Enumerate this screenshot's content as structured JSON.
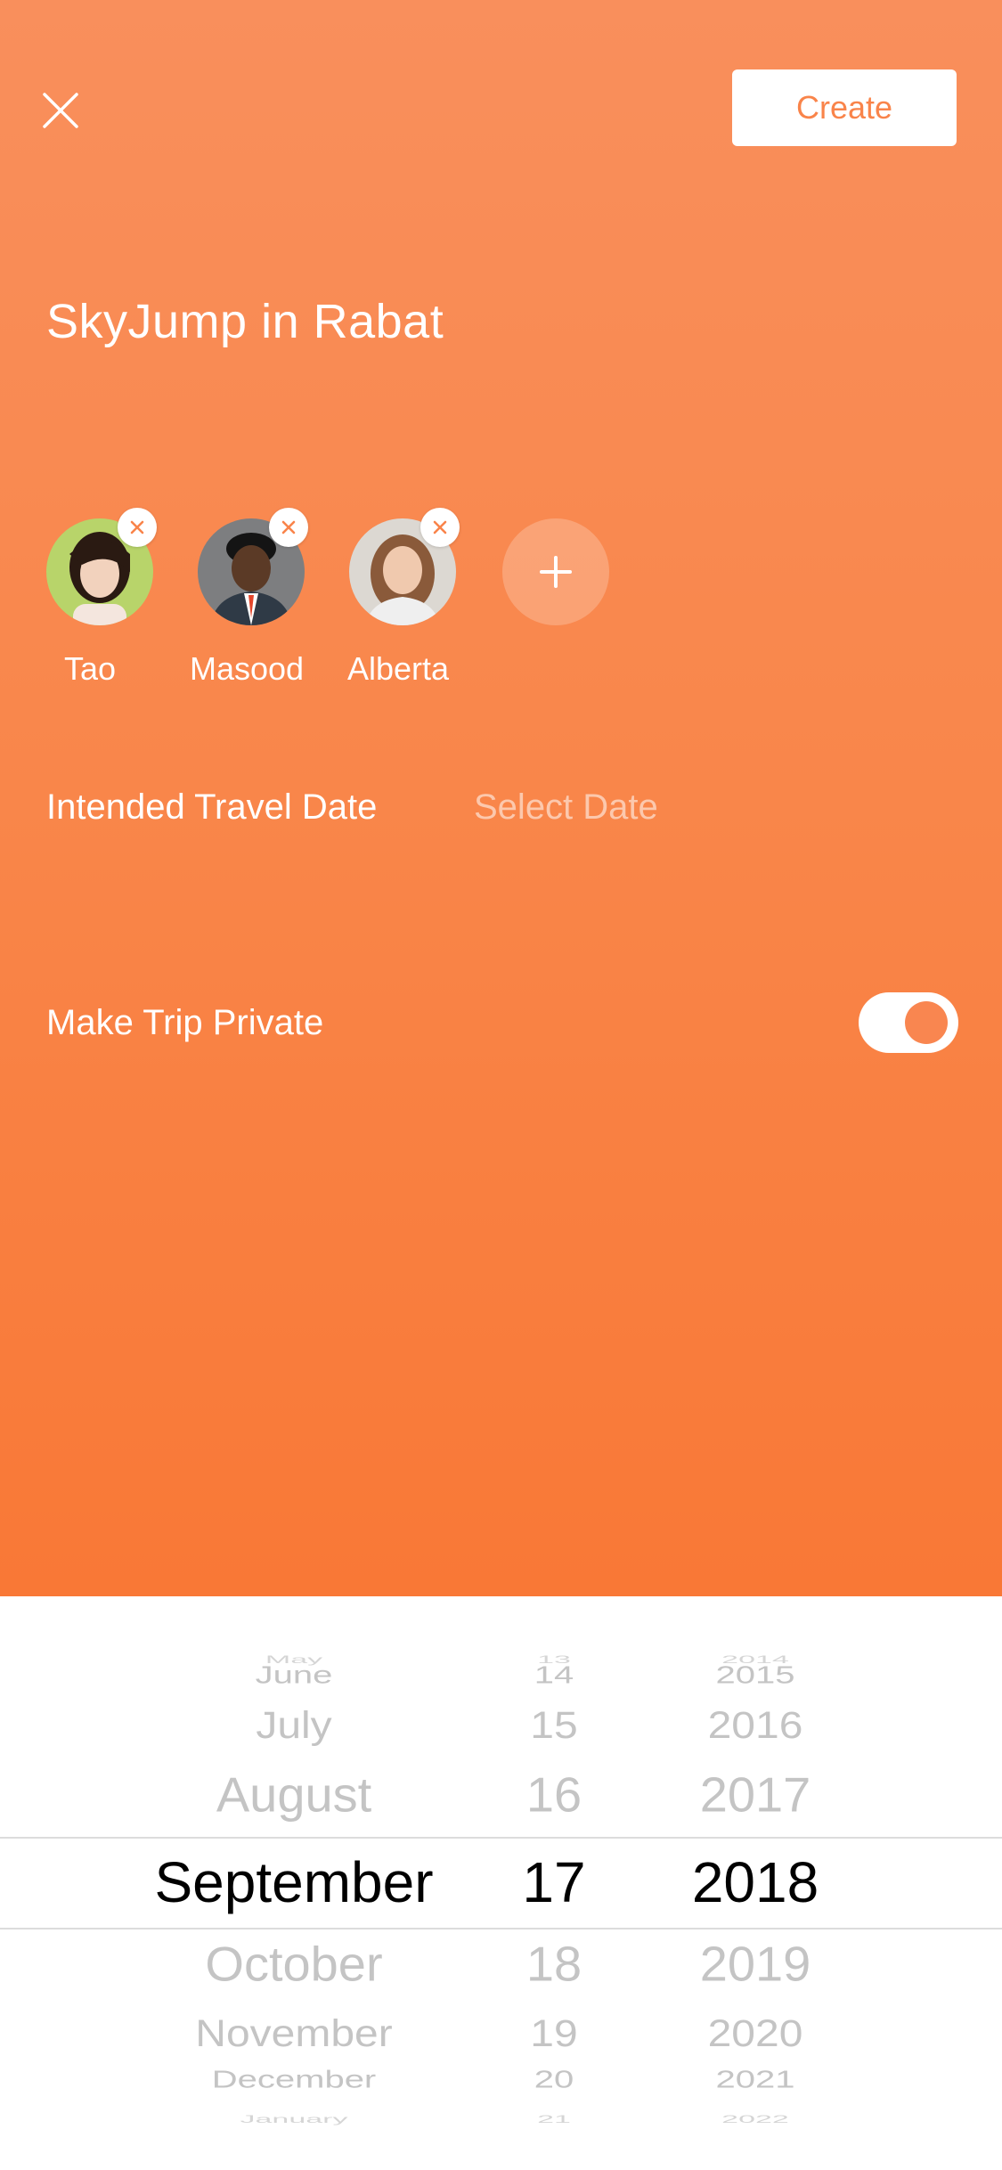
{
  "header": {
    "close_icon": "close-icon",
    "create_label": "Create"
  },
  "trip": {
    "title": "SkyJump in Rabat"
  },
  "members": [
    {
      "name": "Tao"
    },
    {
      "name": "Masood"
    },
    {
      "name": "Alberta"
    }
  ],
  "add_member_icon": "plus-icon",
  "travel_date": {
    "label": "Intended Travel Date",
    "value": "Select Date"
  },
  "privacy": {
    "label": "Make Trip Private",
    "enabled": true
  },
  "date_picker": {
    "months": [
      "May",
      "June",
      "July",
      "August",
      "September",
      "October",
      "November",
      "December",
      "January"
    ],
    "days": [
      "13",
      "14",
      "15",
      "16",
      "17",
      "18",
      "19",
      "20",
      "21"
    ],
    "years": [
      "2014",
      "2015",
      "2016",
      "2017",
      "2018",
      "2019",
      "2020",
      "2021",
      "2022"
    ],
    "selected": {
      "month": "September",
      "day": "17",
      "year": "2018"
    }
  },
  "colors": {
    "accent": "#f9844a",
    "background_top": "#f98f5c",
    "background_bottom": "#f97836",
    "picker_selected": "#000000",
    "picker_unselected": "#c4c4c4"
  }
}
